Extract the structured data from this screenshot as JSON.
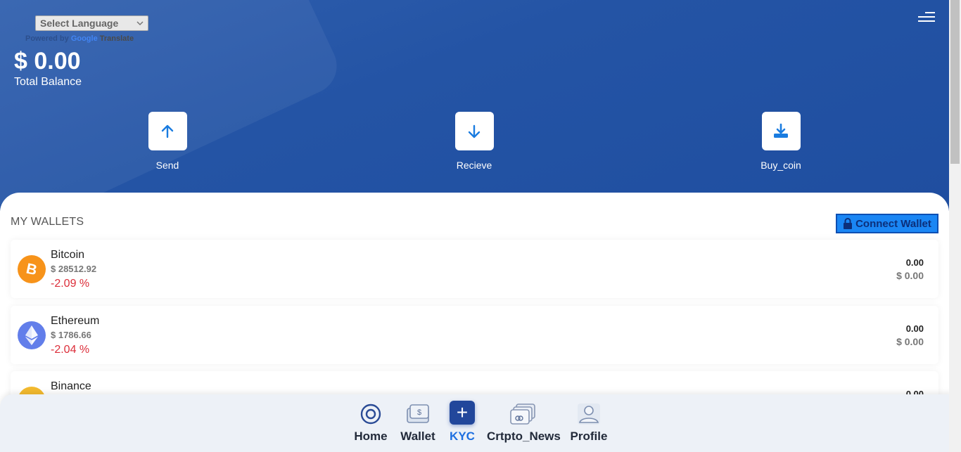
{
  "translate": {
    "select_label": "Select Language",
    "powered_by": "Powered by",
    "google": "Google",
    "translate_word": "Translate"
  },
  "balance": {
    "amount": "$ 0.00",
    "label": "Total Balance"
  },
  "actions": [
    {
      "label": "Send",
      "icon": "arrow-up-icon"
    },
    {
      "label": "Recieve",
      "icon": "arrow-down-icon"
    },
    {
      "label": "Buy_coin",
      "icon": "download-icon"
    }
  ],
  "wallets": {
    "title": "MY WALLETS",
    "connect_label": "Connect Wallet",
    "items": [
      {
        "name": "Bitcoin",
        "price": "$ 28512.92",
        "change": "-2.09 %",
        "amount": "0.00",
        "usd": "$ 0.00",
        "icon": "bitcoin-icon",
        "color": "#f7931a"
      },
      {
        "name": "Ethereum",
        "price": "$ 1786.66",
        "change": "-2.04 %",
        "amount": "0.00",
        "usd": "$ 0.00",
        "icon": "ethereum-icon",
        "color": "#627eea"
      },
      {
        "name": "Binance",
        "price": "",
        "change": "",
        "amount": "0.00",
        "usd": "",
        "icon": "binance-icon",
        "color": "#f3ba2f"
      }
    ]
  },
  "bottom_nav": [
    {
      "label": "Home",
      "icon": "home-icon"
    },
    {
      "label": "Wallet",
      "icon": "wallet-icon"
    },
    {
      "label": "KYC",
      "icon": "plus-icon",
      "active": true
    },
    {
      "label": "Crtpto_News",
      "icon": "cards-icon"
    },
    {
      "label": "Profile",
      "icon": "user-icon"
    }
  ],
  "colors": {
    "header_bg": "#2454a5",
    "accent": "#1a86f4",
    "negative": "#dc2e3a",
    "nav_bg": "#edf1f7"
  }
}
